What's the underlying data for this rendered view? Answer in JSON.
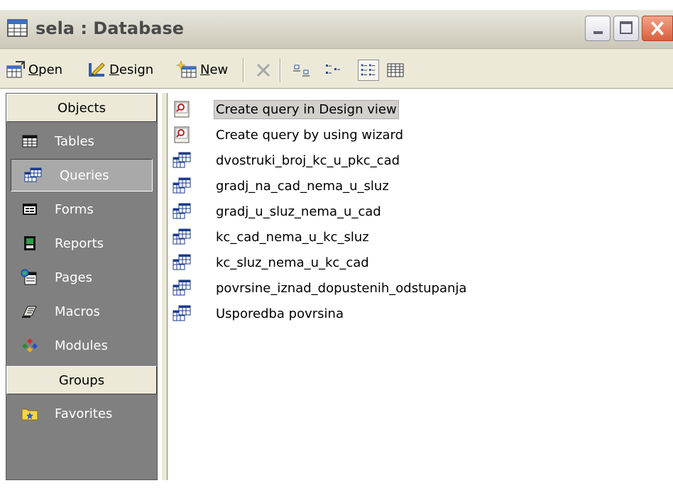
{
  "window": {
    "title": "sela : Database"
  },
  "toolbar": {
    "open_label_underline": "O",
    "open_label_rest": "pen",
    "design_label_underline": "D",
    "design_label_rest": "esign",
    "new_label_underline": "N",
    "new_label_rest": "ew"
  },
  "objects_bar": {
    "header": "Objects",
    "items": [
      {
        "label": "Tables",
        "icon": "table-icon"
      },
      {
        "label": "Queries",
        "icon": "query-icon",
        "selected": true
      },
      {
        "label": "Forms",
        "icon": "form-icon"
      },
      {
        "label": "Reports",
        "icon": "report-icon"
      },
      {
        "label": "Pages",
        "icon": "page-icon"
      },
      {
        "label": "Macros",
        "icon": "macro-icon"
      },
      {
        "label": "Modules",
        "icon": "module-icon"
      }
    ],
    "groups_header": "Groups",
    "groups": [
      {
        "label": "Favorites",
        "icon": "favorites-icon"
      }
    ]
  },
  "list": {
    "items": [
      {
        "label": "Create query in Design view",
        "icon": "wizard-icon",
        "selected": true
      },
      {
        "label": "Create query by using wizard",
        "icon": "wizard-icon"
      },
      {
        "label": "dvostruki_broj_kc_u_pkc_cad",
        "icon": "query-icon"
      },
      {
        "label": "gradj_na_cad_nema_u_sluz",
        "icon": "query-icon"
      },
      {
        "label": "gradj_u_sluz_nema_u_cad",
        "icon": "query-icon"
      },
      {
        "label": "kc_cad_nema_u_kc_sluz",
        "icon": "query-icon"
      },
      {
        "label": "kc_sluz_nema_u_kc_cad",
        "icon": "query-icon"
      },
      {
        "label": "povrsine_iznad_dopustenih_odstupanja",
        "icon": "query-icon"
      },
      {
        "label": "Usporedba povrsina",
        "icon": "query-icon"
      }
    ]
  },
  "colors": {
    "objects_bar_bg": "#808080",
    "selection_bg": "#d3d0cc",
    "window_bg": "#ece9d8"
  }
}
